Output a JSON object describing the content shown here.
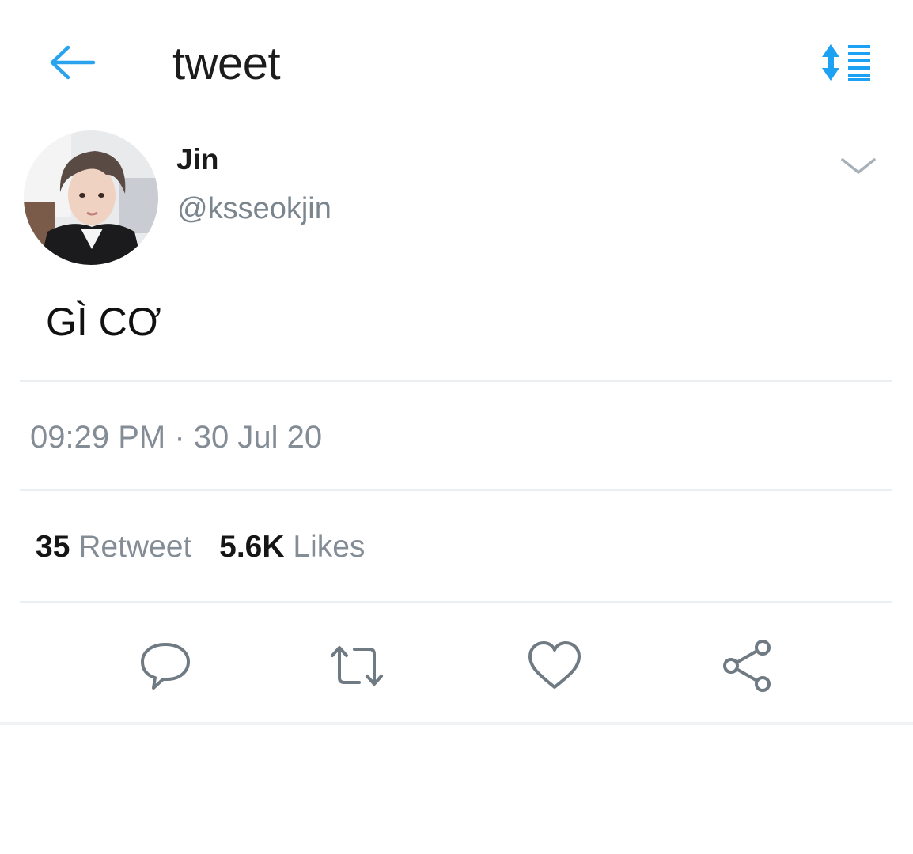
{
  "header": {
    "title": "tweet",
    "back_icon": "arrow-left-icon",
    "sort_icon": "sort-list-icon",
    "accent_color": "#1da1f2"
  },
  "tweet": {
    "author": {
      "name": "Jin",
      "handle": "@ksseokjin",
      "avatar_icon": "user-avatar-photo"
    },
    "text": "GÌ CƠ",
    "timestamp": "09:29 PM · 30 Jul 20",
    "stats": {
      "retweets_count": "35",
      "retweets_label": "Retweet",
      "likes_count": "5.6K",
      "likes_label": "Likes"
    },
    "actions": [
      {
        "name": "reply",
        "icon": "comment-bubble-icon"
      },
      {
        "name": "retweet",
        "icon": "retweet-icon"
      },
      {
        "name": "like",
        "icon": "heart-icon"
      },
      {
        "name": "share",
        "icon": "share-nodes-icon"
      }
    ]
  },
  "colors": {
    "secondary_text": "#848d96",
    "icon_gray": "#6f7a83",
    "divider": "#eceff1"
  }
}
